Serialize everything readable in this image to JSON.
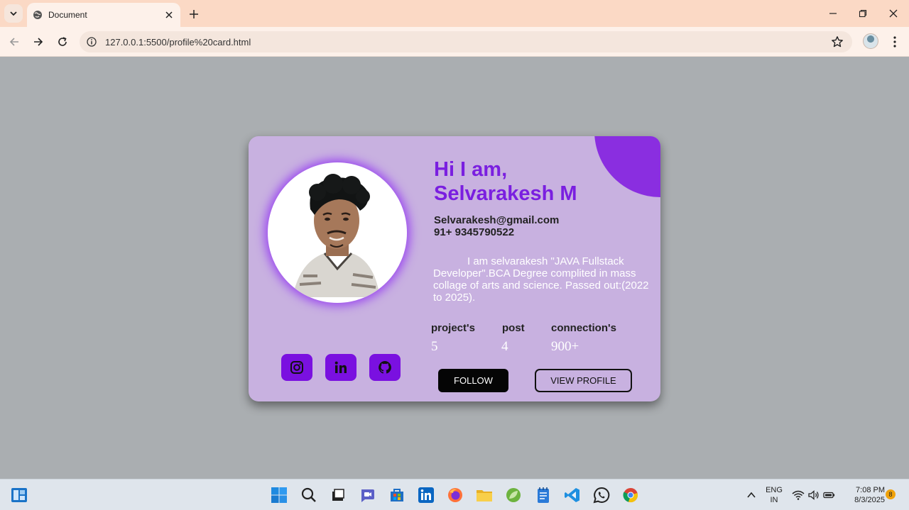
{
  "browser": {
    "tab_title": "Document",
    "url": "127.0.0.1:5500/profile%20card.html"
  },
  "card": {
    "greeting_line1": "Hi I am,",
    "greeting_line2": "Selvarakesh M",
    "email": "Selvarakesh@gmail.com",
    "phone": "91+ 9345790522",
    "bio": "I am selvarakesh \"JAVA Fullstack Developer\".BCA Degree complited in mass collage of arts and science. Passed out:(2022 to 2025).",
    "stats": [
      {
        "label": "project's",
        "value": "5"
      },
      {
        "label": "post",
        "value": "4"
      },
      {
        "label": "connection's",
        "value": "900+"
      }
    ],
    "social": [
      "instagram-icon",
      "linkedin-icon",
      "github-icon"
    ],
    "follow_label": "FOLLOW",
    "view_profile_label": "VIEW PROFILE",
    "colors": {
      "card_bg": "#c8b1e0",
      "accent": "#7a1fe0",
      "social_bg": "#7a10e0"
    }
  },
  "taskbar": {
    "lang_line1": "ENG",
    "lang_line2": "IN",
    "time": "7:08 PM",
    "date": "8/3/2025",
    "notification_count": "8"
  }
}
